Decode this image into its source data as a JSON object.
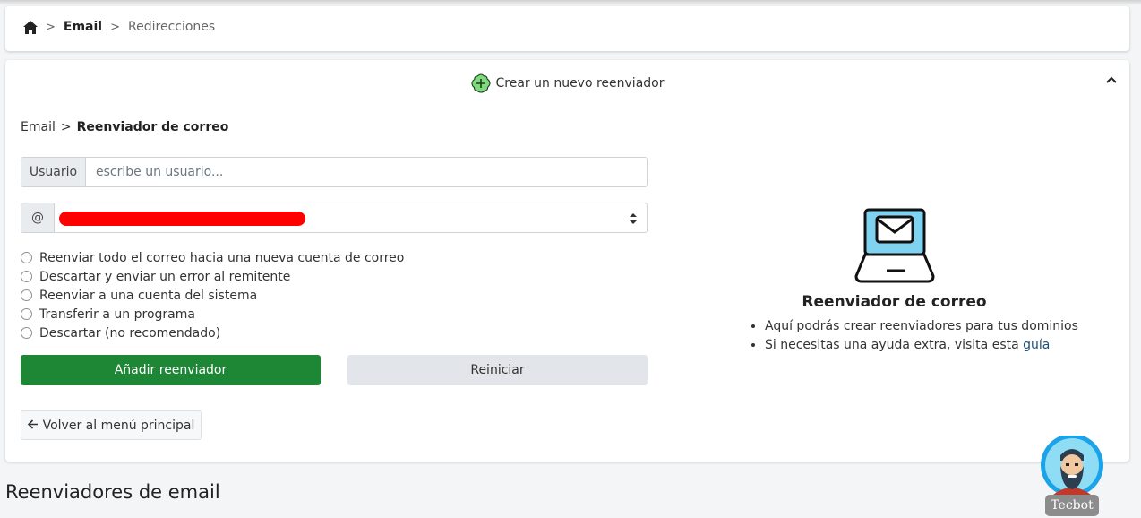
{
  "breadcrumb": {
    "home_icon": "home-icon",
    "separator": ">",
    "level1": "Email",
    "level2": "Redirecciones"
  },
  "panel": {
    "header": "Crear un nuevo reenviador",
    "plus_icon": "plus-circle-icon",
    "collapse_icon": "chevron-up-icon",
    "sub_breadcrumb": {
      "level1": "Email",
      "separator": ">",
      "level2": "Reenviador de correo"
    }
  },
  "form": {
    "user_addon": "Usuario",
    "user_placeholder": "escribe un usuario...",
    "user_value": "",
    "domain_addon": "@",
    "domain_value_redacted": true,
    "options": [
      "Reenviar todo el correo hacia una nueva cuenta de correo",
      "Descartar y enviar un error al remitente",
      "Reenviar a una cuenta del sistema",
      "Transferir a un programa",
      "Descartar (no recomendado)"
    ],
    "add_button": "Añadir reenviador",
    "reset_button": "Reiniciar",
    "back_button": "Volver al menú principal"
  },
  "info": {
    "icon": "laptop-mail-icon",
    "title": "Reenviador de correo",
    "bullets": [
      {
        "text": "Aquí podrás crear reenviadores para tus dominios",
        "link": ""
      },
      {
        "text": "Si necesitas una ayuda extra, visita esta ",
        "link": "guía"
      }
    ]
  },
  "section": {
    "title": "Reenviadores de email"
  },
  "bot": {
    "label": "Tecbot"
  },
  "colors": {
    "primary_green": "#1e8735",
    "reset_gray": "#e2e5e9",
    "bot_blue": "#1aa3e8"
  }
}
